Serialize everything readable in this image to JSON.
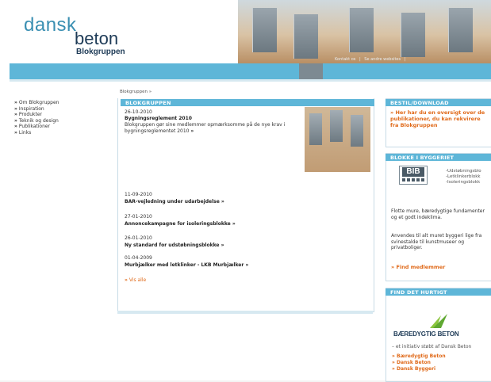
{
  "brand": {
    "word1": "dansk",
    "word2": "beton",
    "sub": "Blokgruppen"
  },
  "top_links": [
    "Kontakt os",
    "|",
    "Se andre websites",
    "|"
  ],
  "breadcrumb": "Blokgruppen »",
  "left_nav": [
    "Om Blokgruppen",
    "Inspiration",
    "Produkter",
    "Teknik og design",
    "Publikationer",
    "Links"
  ],
  "main": {
    "heading": "BLOKGRUPPEN",
    "featured": {
      "date": "26-10-2010",
      "title": "Bygningsreglement 2010",
      "text": "Blokgruppen gør sine medlemmer opmærksomme på de nye krav i bygningsreglementet 2010",
      "more": "»"
    },
    "news": [
      {
        "date": "11-09-2010",
        "title": "BAR-vejledning under udarbejdelse"
      },
      {
        "date": "27-01-2010",
        "title": "Annoncekampagne for isoleringsblokke"
      },
      {
        "date": "26-01-2010",
        "title": "Ny standard for udstøbningsblokke"
      },
      {
        "date": "01-04-2009",
        "title": "Murbjælker med letklinker - LKB Murbjælker"
      }
    ],
    "more_marker": "»",
    "all_marker": "»",
    "all_label": "Vis alle"
  },
  "right": {
    "order": {
      "heading": "BESTIL/DOWNLOAD",
      "marker": "»",
      "text": "Her har du en oversigt over de publikationer, du kan rekvirere fra Blokgruppen"
    },
    "blocks": {
      "heading": "BLOKKE I BYGGERIET",
      "logo_text": "BIB",
      "list": [
        "-Udstøbningsblo",
        "-Letklinkerblokk",
        "-Isoleringsblokk"
      ],
      "para1": "Flotte mure, bæredygtige fundamenter og et godt indeklima.",
      "para2": "Anvendes til alt muret byggeri lige fra svinestalde til kunstmuseer og privatboliger.",
      "link_marker": "»",
      "link": "Find medlemmer"
    },
    "quick": {
      "heading": "FIND DET HURTIGT",
      "logo_title": "BÆREDYGTIG BETON",
      "logo_sub": "– et initiativ støbt af Dansk Beton",
      "marker": "»",
      "links": [
        "Bæredygtig Beton",
        "Dansk Beton",
        "Dansk Byggeri"
      ]
    }
  },
  "colors": {
    "accent": "#5eb6d8",
    "link": "#e06a1a",
    "brand_dark": "#1e3b57",
    "brand_light": "#3a8fb2"
  }
}
